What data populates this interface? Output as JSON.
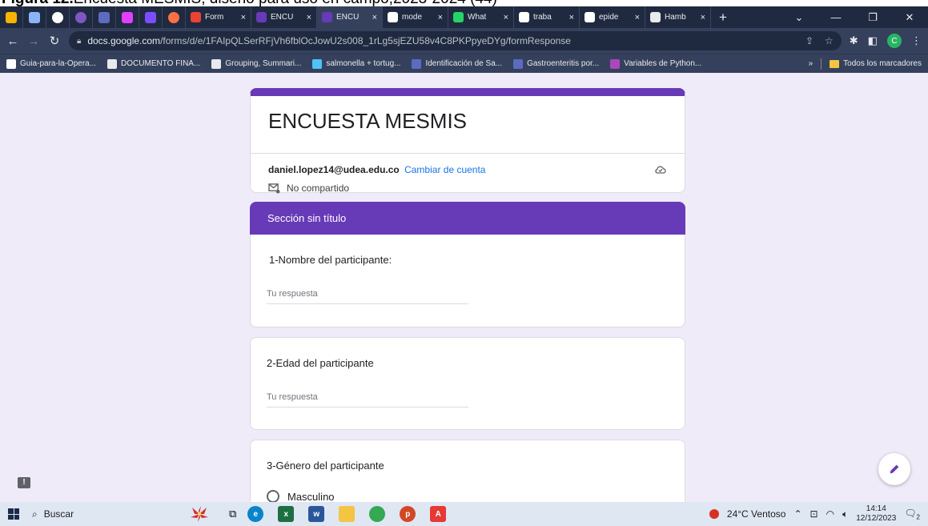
{
  "caption": {
    "bold": "Figura 12.",
    "text": "Encuesta MESMIS, diseño para uso en campo,2023-2024 (44)"
  },
  "tabs": [
    {
      "label": "Form",
      "icon": "gmail-icon",
      "color": "#ea4335"
    },
    {
      "label": "ENCU",
      "icon": "forms-icon",
      "color": "#673ab7"
    },
    {
      "label": "ENCU",
      "icon": "forms-icon",
      "color": "#673ab7",
      "active": true
    },
    {
      "label": "mode",
      "icon": "google-icon",
      "color": "#ffffff"
    },
    {
      "label": "What",
      "icon": "whatsapp-icon",
      "color": "#25d366"
    },
    {
      "label": "traba",
      "icon": "google-icon",
      "color": "#ffffff"
    },
    {
      "label": "epide",
      "icon": "google-icon",
      "color": "#ffffff"
    },
    {
      "label": "Hamb",
      "icon": "af-icon",
      "color": "#e8eaed"
    }
  ],
  "tab_close": "×",
  "tab_add": "+",
  "address": {
    "host": "docs.google.com",
    "path": "/forms/d/e/1FAIpQLSerRFjVh6fblOcJowU2s008_1rLg5sjEZU58v4C8PKPpyeDYg/formResponse"
  },
  "profile_letter": "C",
  "bookmarks": [
    {
      "label": "Guia-para-la-Opera...",
      "color": "#ffffff"
    },
    {
      "label": "DOCUMENTO FINA...",
      "color": "#e8eaed"
    },
    {
      "label": "Grouping, Summari...",
      "color": "#e8eaed"
    },
    {
      "label": "salmonella + tortug...",
      "color": "#4fc3f7"
    },
    {
      "label": "Identificación de Sa...",
      "color": "#5c6bc0"
    },
    {
      "label": "Gastroenteritis por...",
      "color": "#5c6bc0"
    },
    {
      "label": "Variables de Python...",
      "color": "#ab47bc"
    }
  ],
  "bookmarks_more": "»",
  "bookmarks_all": "Todos los marcadores",
  "form": {
    "title": "ENCUESTA MESMIS",
    "email": "daniel.lopez14@udea.edu.co",
    "switch_account": "Cambiar de cuenta",
    "not_shared": "No compartido",
    "section_title": "Sección sin título",
    "questions": [
      {
        "label": "1-Nombre del participante:",
        "placeholder": "Tu respuesta"
      },
      {
        "label": "2-Edad del participante",
        "placeholder": "Tu respuesta"
      },
      {
        "label": "3-Género del participante",
        "option": "Masculino"
      }
    ],
    "accent": "#673ab7",
    "report_glyph": "!"
  },
  "taskbar": {
    "search": "Buscar",
    "weather": "24°C Ventoso",
    "time": "14:14",
    "date": "12/12/2023",
    "notif_count": "2"
  }
}
